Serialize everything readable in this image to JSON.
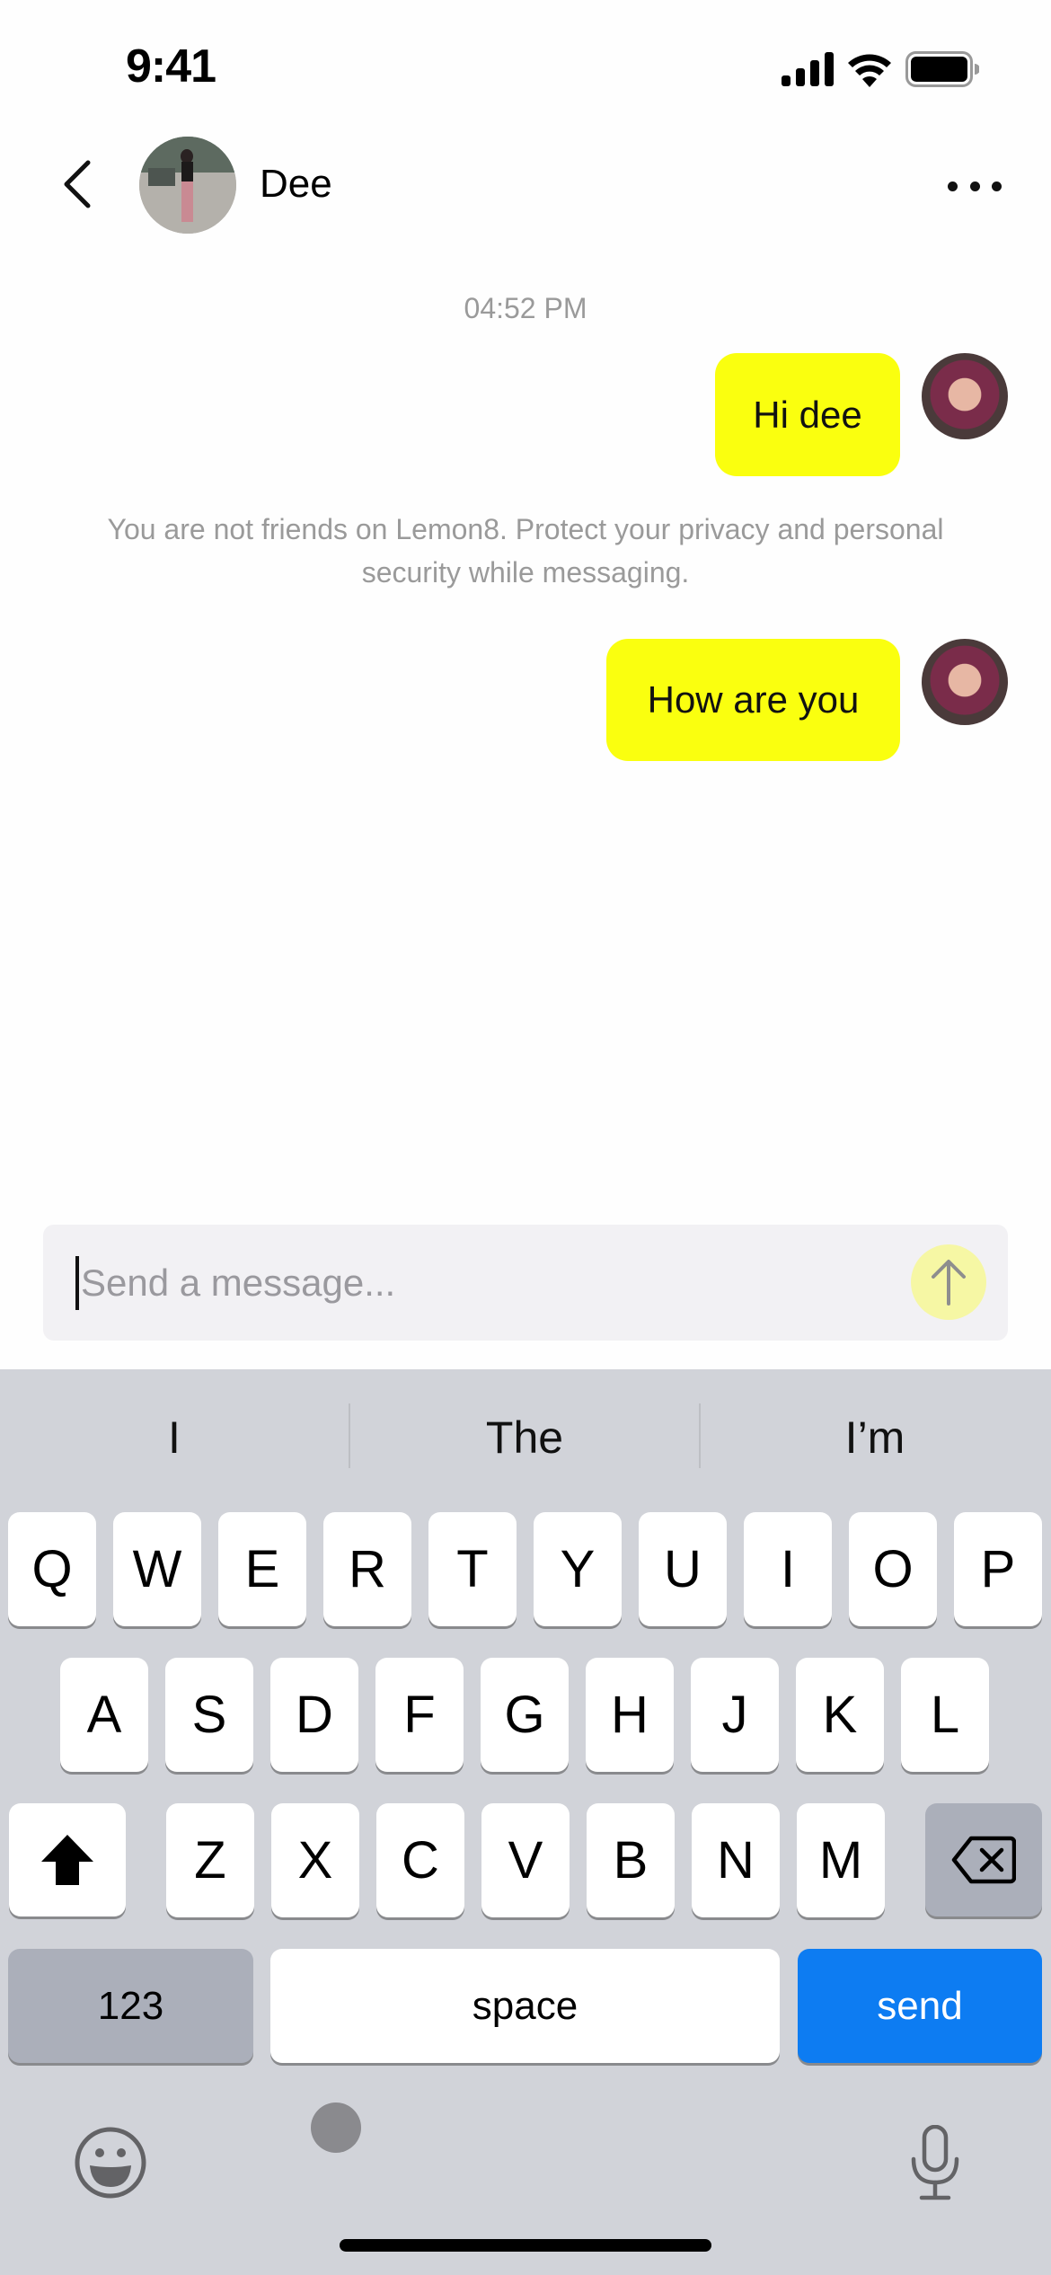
{
  "status_bar": {
    "time": "9:41",
    "icons": [
      "cellular-signal-icon",
      "wifi-icon",
      "battery-icon"
    ]
  },
  "header": {
    "back_icon": "chevron-left-icon",
    "contact_name": "Dee",
    "more_icon": "ellipsis-icon"
  },
  "chat": {
    "timestamp": "04:52 PM",
    "messages": [
      {
        "sender": "me",
        "text": "Hi dee"
      },
      {
        "sender": "me",
        "text": "How are you"
      }
    ],
    "notice": "You are not friends on Lemon8. Protect your privacy and personal security while messaging."
  },
  "composer": {
    "placeholder": "Send a message...",
    "value": "",
    "send_icon": "arrow-up-icon"
  },
  "keyboard": {
    "suggestions": [
      "I",
      "The",
      "I’m"
    ],
    "rows": [
      [
        "Q",
        "W",
        "E",
        "R",
        "T",
        "Y",
        "U",
        "I",
        "O",
        "P"
      ],
      [
        "A",
        "S",
        "D",
        "F",
        "G",
        "H",
        "J",
        "K",
        "L"
      ],
      [
        "Z",
        "X",
        "C",
        "V",
        "B",
        "N",
        "M"
      ]
    ],
    "shift_icon": "shift-icon",
    "delete_icon": "delete-backspace-icon",
    "numbers_label": "123",
    "space_label": "space",
    "return_label": "send",
    "emoji_icon": "emoji-icon",
    "mic_icon": "microphone-icon"
  },
  "colors": {
    "bubble": "#FAFF0F",
    "send_key": "#0D7CF2",
    "keyboard_bg": "#D1D3D9"
  }
}
